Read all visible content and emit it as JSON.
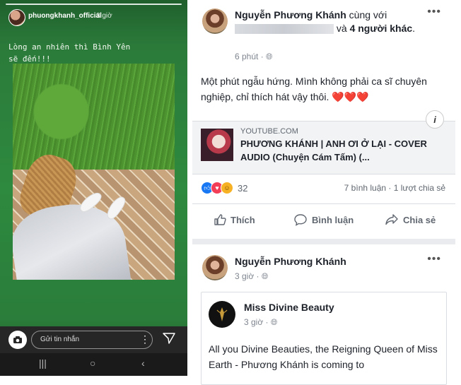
{
  "story": {
    "username": "phuongkhanh_official",
    "time": "3 giờ",
    "caption": "Lòng an nhiên thì Bình Yên\nsẽ đến!!!",
    "message_placeholder": "Gửi tin nhắn"
  },
  "post1": {
    "author": "Nguyễn Phương Khánh",
    "with_label": "cùng với",
    "and_label": "và",
    "others": "4 người khác",
    "time": "6 phút",
    "text": "Một phút ngẫu hứng. Mình không phải ca sĩ chuyên nghiệp, chỉ thích hát vậy thôi. ❤️❤️❤️",
    "link_source": "YOUTUBE.COM",
    "link_title": "PHƯƠNG KHÁNH | ANH ƠI Ở LẠI - COVER AUDIO (Chuyện Cám Tấm) (...",
    "reaction_count": "32",
    "comments": "7 bình luận",
    "shares": "1 lượt chia sẻ",
    "actions": {
      "like": "Thích",
      "comment": "Bình luận",
      "share": "Chia sẻ"
    }
  },
  "post2": {
    "author": "Nguyễn Phương Khánh",
    "time": "3 giờ",
    "embedded": {
      "page_name": "Miss Divine Beauty",
      "time": "3 giờ",
      "text": "All you Divine Beauties, the Reigning Queen of Miss Earth - Phương Khánh is coming to"
    }
  },
  "colors": {
    "fb_text": "#1d2129",
    "fb_meta": "#7f8690",
    "like_blue": "#1877f2",
    "love_red": "#f33e58",
    "haha_yellow": "#f7b125"
  }
}
